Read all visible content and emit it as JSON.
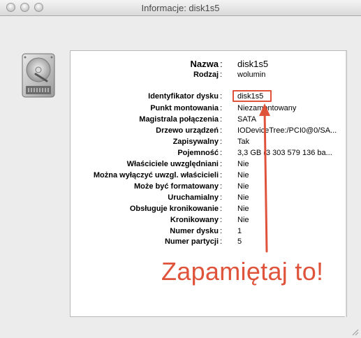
{
  "window": {
    "title": "Informacje: disk1s5"
  },
  "icon": "hard-disk-icon",
  "info": {
    "header": [
      {
        "label": "Nazwa",
        "sep": ":",
        "value": "disk1s5"
      },
      {
        "label": "Rodzaj",
        "sep": ":",
        "value": "wolumin"
      }
    ],
    "rows": [
      {
        "label": "Identyfikator dysku",
        "sep": ":",
        "value": "disk1s5"
      },
      {
        "label": "Punkt montowania",
        "sep": ":",
        "value": "Niezamontowany"
      },
      {
        "label": "Magistrala połączenia",
        "sep": ":",
        "value": "SATA"
      },
      {
        "label": "Drzewo urządzeń",
        "sep": ":",
        "value": "IODeviceTree:/PCI0@0/SA..."
      },
      {
        "label": "Zapisywalny",
        "sep": ":",
        "value": "Tak"
      },
      {
        "label": "Pojemność",
        "sep": ":",
        "value": "3,3 GB (3 303 579 136 ba..."
      },
      {
        "label": "Właściciele uwzględniani",
        "sep": ":",
        "value": "Nie"
      },
      {
        "label": "Można wyłączyć uwzgl. właścicieli",
        "sep": ":",
        "value": "Nie"
      },
      {
        "label": "Może być formatowany",
        "sep": ":",
        "value": "Nie"
      },
      {
        "label": "Uruchamialny",
        "sep": ":",
        "value": "Nie"
      },
      {
        "label": "Obsługuje kronikowanie",
        "sep": ":",
        "value": "Nie"
      },
      {
        "label": "Kronikowany",
        "sep": ":",
        "value": "Nie"
      },
      {
        "label": "Numer dysku",
        "sep": ":",
        "value": "1"
      },
      {
        "label": "Numer partycji",
        "sep": ":",
        "value": "5"
      }
    ]
  },
  "annotation": {
    "text": "Zapamiętaj to!",
    "color": "#e0533b"
  }
}
